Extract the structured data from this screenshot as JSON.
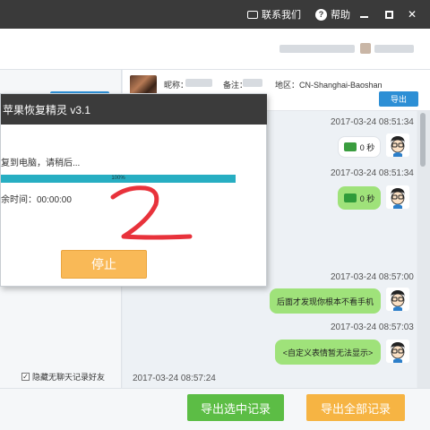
{
  "titlebar": {
    "contact_label": "联系我们",
    "help_label": "帮助",
    "help_glyph": "?",
    "min_glyph": "",
    "close_glyph": "✕"
  },
  "contact_info": {
    "nickname_label": "昵称：",
    "remark_label": "备注：",
    "region_label": "地区：CN-Shanghai-Baoshan",
    "export_label": "导出"
  },
  "dialog": {
    "title": "苹果恢复精灵 v3.1",
    "status_text": "复到电脑，请稍后...",
    "progress_percent": 100,
    "progress_label": "100%",
    "time_text": "余时间：00:00:00",
    "stop_label": "停止"
  },
  "left_panel": {
    "hide_checkbox_label": "隐藏无聊天记录好友",
    "checked": true
  },
  "messages": [
    {
      "timestamp": "2017-03-24 08:51:34",
      "text": "0 秒",
      "type": "voice",
      "bubble": "white"
    },
    {
      "timestamp": "2017-03-24 08:51:34",
      "text": "0 秒",
      "type": "voice",
      "bubble": "green"
    },
    {
      "timestamp": "2017-03-24 08:57:00",
      "text": "后面才发现你根本不看手机",
      "type": "text",
      "bubble": "green"
    },
    {
      "timestamp": "2017-03-24 08:57:03",
      "text": "<自定义表情暂无法显示>",
      "type": "text",
      "bubble": "green"
    },
    {
      "timestamp": "2017-03-24 08:57:24",
      "text": "",
      "type": "text",
      "bubble": "none"
    }
  ],
  "bottom": {
    "export_selected_label": "导出选中记录",
    "export_all_label": "导出全部记录"
  },
  "colors": {
    "titlebar": "#3a3a3a",
    "accent_blue": "#2d8fd5",
    "green_bubble": "#9fe27a",
    "green_button": "#5cbd45",
    "orange_button": "#f6b443",
    "progress": "#27aec2",
    "annotation_red": "#e8323b"
  }
}
